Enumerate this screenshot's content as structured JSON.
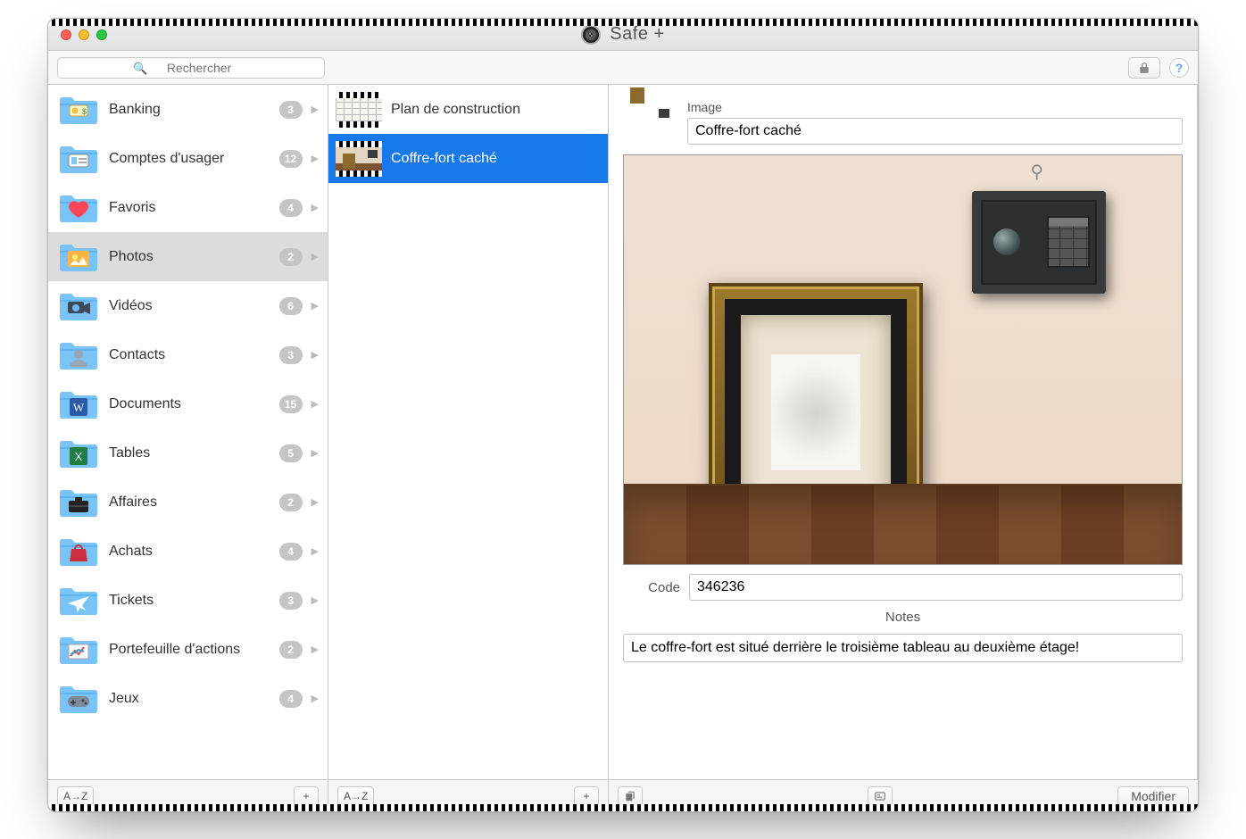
{
  "app": {
    "title": "Safe +"
  },
  "toolbar": {
    "search_placeholder": "Rechercher",
    "lock_icon": "lock-icon",
    "help_label": "?"
  },
  "categories": [
    {
      "id": "banking",
      "label": "Banking",
      "count": 3,
      "icon": "money"
    },
    {
      "id": "accounts",
      "label": "Comptes d'usager",
      "count": 12,
      "icon": "id"
    },
    {
      "id": "favs",
      "label": "Favoris",
      "count": 4,
      "icon": "heart"
    },
    {
      "id": "photos",
      "label": "Photos",
      "count": 2,
      "icon": "photo",
      "selected": true
    },
    {
      "id": "videos",
      "label": "Vidéos",
      "count": 6,
      "icon": "video"
    },
    {
      "id": "contacts",
      "label": "Contacts",
      "count": 3,
      "icon": "contact"
    },
    {
      "id": "docs",
      "label": "Documents",
      "count": 15,
      "icon": "word"
    },
    {
      "id": "tables",
      "label": "Tables",
      "count": 5,
      "icon": "excel"
    },
    {
      "id": "affaires",
      "label": "Affaires",
      "count": 2,
      "icon": "briefcase"
    },
    {
      "id": "achats",
      "label": "Achats",
      "count": 4,
      "icon": "bag"
    },
    {
      "id": "tickets",
      "label": "Tickets",
      "count": 3,
      "icon": "plane"
    },
    {
      "id": "stocks",
      "label": "Portefeuille d'actions",
      "count": 2,
      "icon": "chart"
    },
    {
      "id": "games",
      "label": "Jeux",
      "count": 4,
      "icon": "gamepad"
    }
  ],
  "items": [
    {
      "id": "plan",
      "label": "Plan de construction"
    },
    {
      "id": "coffre",
      "label": "Coffre-fort caché",
      "selected": true
    }
  ],
  "detail": {
    "type_label": "Image",
    "name_value": "Coffre-fort caché",
    "code_label": "Code",
    "code_value": "346236",
    "notes_label": "Notes",
    "notes_value": "Le coffre-fort est situé derrière le troisième tableau au deuxième étage!"
  },
  "footer": {
    "sort_label": "A→Z",
    "add_label": "+",
    "sort_label2": "A→Z",
    "add_label2": "+",
    "modify_label": "Modifier"
  }
}
